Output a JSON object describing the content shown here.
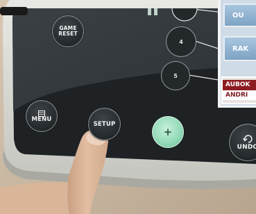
{
  "device": {
    "buttons": {
      "game_reset": [
        "GAME",
        "RESET"
      ],
      "menu": "MENU",
      "setup": "SETUP",
      "plus": "+",
      "undo": "UNDO"
    },
    "number_buttons": [
      "4",
      "5"
    ],
    "screen": {
      "top_button": "OU",
      "middle_button": "RAK",
      "player_box": [
        "AUBOK",
        "ANDRI"
      ]
    }
  },
  "colors": {
    "panel": "#1f2326",
    "bezel": "#dcdcd6",
    "screen_button": "#8fb3d4",
    "player_highlight": "#8c1b22",
    "plus_button": "#a9e5c8"
  }
}
